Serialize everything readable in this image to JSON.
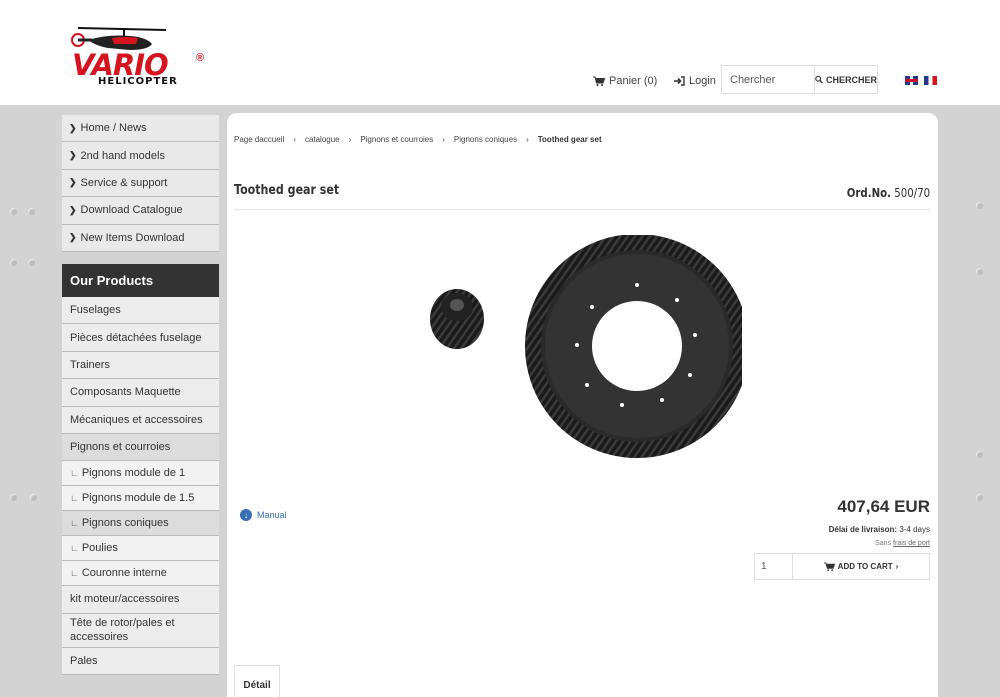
{
  "header": {
    "logo": {
      "word": "VARIO",
      "reg": "®",
      "sub": "HELICOPTER"
    },
    "cart_label": "Panier (0)",
    "login_label": "Login",
    "search_placeholder": "Chercher",
    "search_button": "CHERCHER",
    "languages": [
      "en-flag",
      "fr-flag"
    ]
  },
  "sidebar": {
    "nav": [
      {
        "label": "Home / News"
      },
      {
        "label": "2nd hand models"
      },
      {
        "label": "Service & support"
      },
      {
        "label": "Download Catalogue"
      },
      {
        "label": "New Items Download"
      }
    ],
    "products_title": "Our Products",
    "products": [
      {
        "label": "Fuselages"
      },
      {
        "label": "Pièces détachées fuselage"
      },
      {
        "label": "Trainers"
      },
      {
        "label": "Composants Maquette"
      },
      {
        "label": "Mécaniques et accessoires"
      },
      {
        "label": "Pignons et courroies"
      }
    ],
    "subproducts": [
      {
        "label": "Pignons module de 1"
      },
      {
        "label": "Pignons module de 1.5"
      },
      {
        "label": "Pignons coniques"
      },
      {
        "label": "Poulies"
      },
      {
        "label": "Couronne interne"
      }
    ],
    "products_more": [
      {
        "label": "kit moteur/accessoires"
      },
      {
        "label": "Tête de rotor/pales et accessoires"
      },
      {
        "label": "Pales"
      }
    ]
  },
  "breadcrumb": [
    "Page daccueil",
    "catalogue",
    "Pignons et courroies",
    "Pignons coniques",
    "Toothed gear set"
  ],
  "product": {
    "title": "Toothed gear set",
    "ordno_label": "Ord.No.",
    "ordno_value": "500/70",
    "manual_label": "Manual",
    "price": "407,64 EUR",
    "delivery_label": "Délai de livraison:",
    "delivery_value": "3-4 days",
    "shipping_prefix": "Sans",
    "shipping_link": "frais de port",
    "quantity": "1",
    "add_to_cart": "ADD TO CART",
    "tab_detail": "Détail"
  },
  "colors": {
    "brand_red": "#d6141f",
    "link_blue": "#3a6fb4",
    "sidebar_dark": "#333333"
  }
}
